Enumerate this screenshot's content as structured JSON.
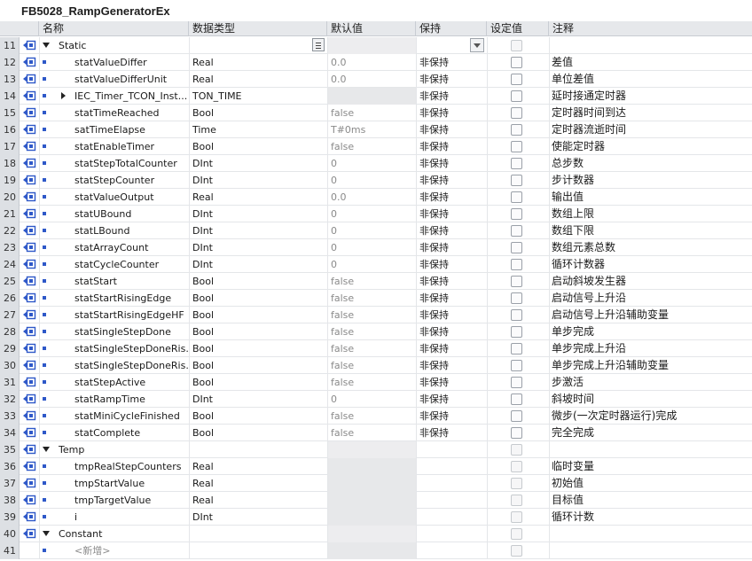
{
  "block_title": "FB5028_RampGeneratorEx",
  "columns": {
    "name": "名称",
    "datatype": "数据类型",
    "default": "默认值",
    "retain": "保持",
    "setpoint": "设定值",
    "comment": "注释"
  },
  "rows": [
    {
      "num": "11",
      "kind": "section",
      "name": "Static",
      "type": "",
      "default": "",
      "retain": "",
      "comment": ""
    },
    {
      "num": "12",
      "kind": "var",
      "name": "statValueDiffer",
      "type": "Real",
      "default": "0.0",
      "retain": "非保持",
      "comment": "差值"
    },
    {
      "num": "13",
      "kind": "var",
      "name": "statValueDifferUnit",
      "type": "Real",
      "default": "0.0",
      "retain": "非保持",
      "comment": "单位差值"
    },
    {
      "num": "14",
      "kind": "struct",
      "name": "IEC_Timer_TCON_Inst...",
      "type": "TON_TIME",
      "default": "",
      "retain": "非保持",
      "comment": "延时接通定时器"
    },
    {
      "num": "15",
      "kind": "var",
      "name": "statTimeReached",
      "type": "Bool",
      "default": "false",
      "retain": "非保持",
      "comment": "定时器时间到达"
    },
    {
      "num": "16",
      "kind": "var",
      "name": "satTimeElapse",
      "type": "Time",
      "default": "T#0ms",
      "retain": "非保持",
      "comment": "定时器流逝时间"
    },
    {
      "num": "17",
      "kind": "var",
      "name": "statEnableTimer",
      "type": "Bool",
      "default": "false",
      "retain": "非保持",
      "comment": "使能定时器"
    },
    {
      "num": "18",
      "kind": "var",
      "name": "statStepTotalCounter",
      "type": "DInt",
      "default": "0",
      "retain": "非保持",
      "comment": "总步数"
    },
    {
      "num": "19",
      "kind": "var",
      "name": "statStepCounter",
      "type": "DInt",
      "default": "0",
      "retain": "非保持",
      "comment": "步计数器"
    },
    {
      "num": "20",
      "kind": "var",
      "name": "statValueOutput",
      "type": "Real",
      "default": "0.0",
      "retain": "非保持",
      "comment": "输出值"
    },
    {
      "num": "21",
      "kind": "var",
      "name": "statUBound",
      "type": "DInt",
      "default": "0",
      "retain": "非保持",
      "comment": "数组上限"
    },
    {
      "num": "22",
      "kind": "var",
      "name": "statLBound",
      "type": "DInt",
      "default": "0",
      "retain": "非保持",
      "comment": "数组下限"
    },
    {
      "num": "23",
      "kind": "var",
      "name": "statArrayCount",
      "type": "DInt",
      "default": "0",
      "retain": "非保持",
      "comment": "数组元素总数"
    },
    {
      "num": "24",
      "kind": "var",
      "name": "statCycleCounter",
      "type": "DInt",
      "default": "0",
      "retain": "非保持",
      "comment": "循环计数器"
    },
    {
      "num": "25",
      "kind": "var",
      "name": "statStart",
      "type": "Bool",
      "default": "false",
      "retain": "非保持",
      "comment": "启动斜坡发生器"
    },
    {
      "num": "26",
      "kind": "var",
      "name": "statStartRisingEdge",
      "type": "Bool",
      "default": "false",
      "retain": "非保持",
      "comment": "启动信号上升沿"
    },
    {
      "num": "27",
      "kind": "var",
      "name": "statStartRisingEdgeHF",
      "type": "Bool",
      "default": "false",
      "retain": "非保持",
      "comment": "启动信号上升沿辅助变量"
    },
    {
      "num": "28",
      "kind": "var",
      "name": "statSingleStepDone",
      "type": "Bool",
      "default": "false",
      "retain": "非保持",
      "comment": "单步完成"
    },
    {
      "num": "29",
      "kind": "var",
      "name": "statSingleStepDoneRis...",
      "type": "Bool",
      "default": "false",
      "retain": "非保持",
      "comment": "单步完成上升沿"
    },
    {
      "num": "30",
      "kind": "var",
      "name": "statSingleStepDoneRis...",
      "type": "Bool",
      "default": "false",
      "retain": "非保持",
      "comment": "单步完成上升沿辅助变量"
    },
    {
      "num": "31",
      "kind": "var",
      "name": "statStepActive",
      "type": "Bool",
      "default": "false",
      "retain": "非保持",
      "comment": "步激活"
    },
    {
      "num": "32",
      "kind": "var",
      "name": "statRampTime",
      "type": "DInt",
      "default": "0",
      "retain": "非保持",
      "comment": "斜坡时间"
    },
    {
      "num": "33",
      "kind": "var",
      "name": "statMiniCycleFinished",
      "type": "Bool",
      "default": "false",
      "retain": "非保持",
      "comment": "微步(一次定时器运行)完成"
    },
    {
      "num": "34",
      "kind": "var",
      "name": "statComplete",
      "type": "Bool",
      "default": "false",
      "retain": "非保持",
      "comment": "完全完成"
    },
    {
      "num": "35",
      "kind": "section",
      "name": "Temp",
      "type": "",
      "default": "",
      "retain": "",
      "comment": ""
    },
    {
      "num": "36",
      "kind": "temp",
      "name": "tmpRealStepCounters",
      "type": "Real",
      "default": "",
      "retain": "",
      "comment": "临时变量"
    },
    {
      "num": "37",
      "kind": "temp",
      "name": "tmpStartValue",
      "type": "Real",
      "default": "",
      "retain": "",
      "comment": "初始值"
    },
    {
      "num": "38",
      "kind": "temp",
      "name": "tmpTargetValue",
      "type": "Real",
      "default": "",
      "retain": "",
      "comment": "目标值"
    },
    {
      "num": "39",
      "kind": "temp",
      "name": "i",
      "type": "DInt",
      "default": "",
      "retain": "",
      "comment": "循环计数"
    },
    {
      "num": "40",
      "kind": "section",
      "name": "Constant",
      "type": "",
      "default": "",
      "retain": "",
      "comment": ""
    },
    {
      "num": "41",
      "kind": "add",
      "name": "<新增>",
      "type": "",
      "default": "",
      "retain": "",
      "comment": ""
    }
  ],
  "icons": {
    "io": "interface-var-icon",
    "expand": "expand-arrow-icon",
    "collapse": "collapse-arrow-icon",
    "member": "member-square-icon"
  },
  "colors": {
    "icon_blue": "#2e58c8",
    "header_bg": "#e6e8eb",
    "default_gray": "#8a8a8a"
  }
}
